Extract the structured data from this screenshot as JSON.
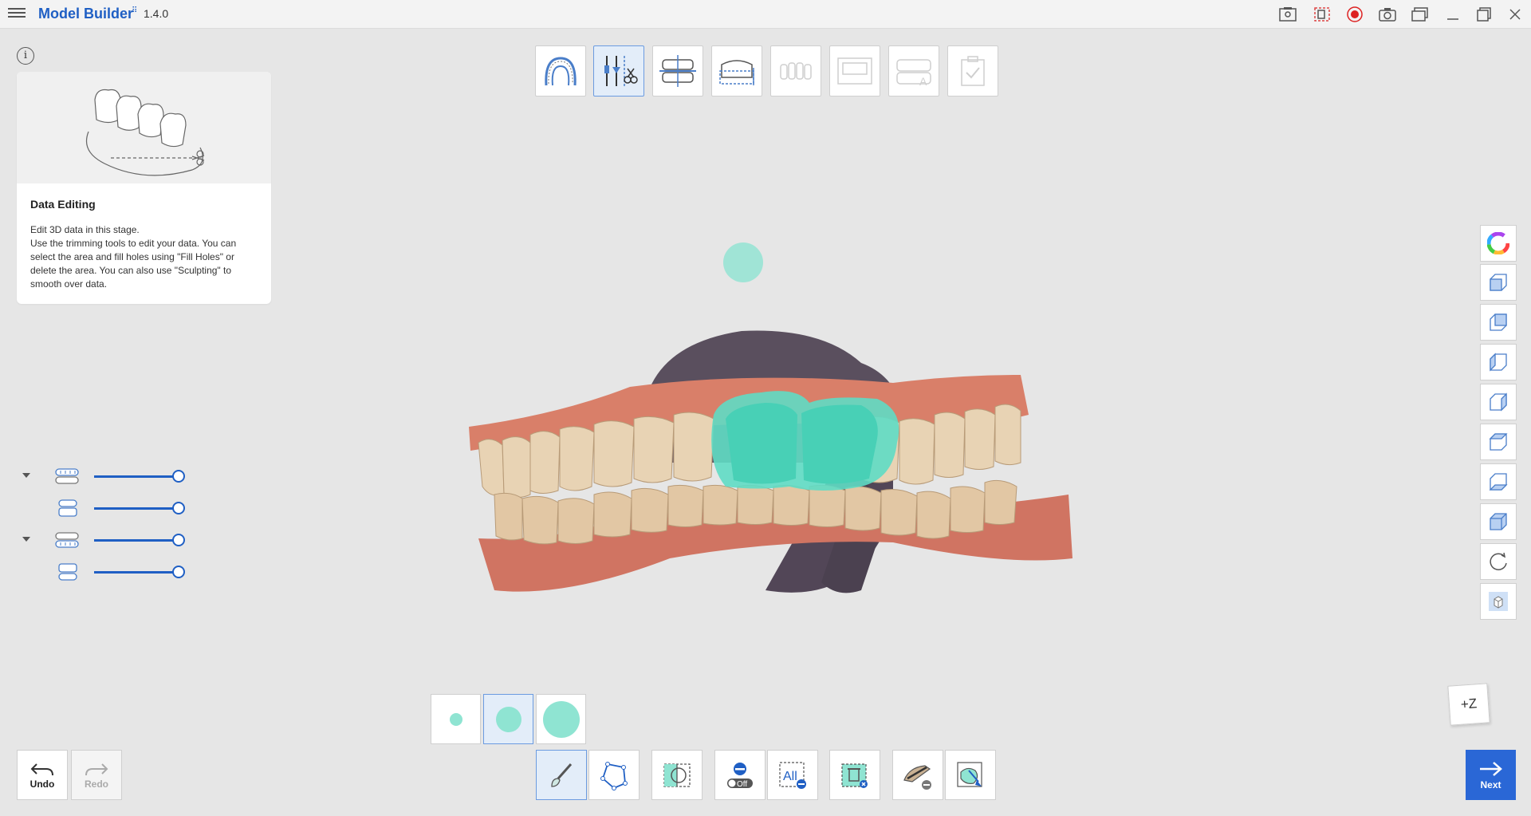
{
  "app": {
    "title": "Model Builder",
    "version": "1.4.0"
  },
  "info": {
    "title": "Data Editing",
    "lines": [
      "Edit 3D data in this stage.",
      "Use the trimming tools to edit your data. You can select the area and fill holes using \"Fill Holes\" or delete the area. You can also use \"Sculpting\" to smooth over data."
    ]
  },
  "stages": [
    {
      "icon": "arch-icon",
      "state": "normal"
    },
    {
      "icon": "edit-tools-icon",
      "state": "active"
    },
    {
      "icon": "occlusion-plane-icon",
      "state": "normal"
    },
    {
      "icon": "base-height-icon",
      "state": "normal"
    },
    {
      "icon": "die-icon",
      "state": "disabled"
    },
    {
      "icon": "model-base-icon",
      "state": "disabled"
    },
    {
      "icon": "label-icon",
      "state": "disabled"
    },
    {
      "icon": "checklist-icon",
      "state": "disabled"
    }
  ],
  "visibility": [
    {
      "name": "upper-jaw",
      "expandable": true,
      "opacity": 1.0
    },
    {
      "name": "upper-sub",
      "expandable": false,
      "opacity": 1.0
    },
    {
      "name": "lower-jaw",
      "expandable": true,
      "opacity": 1.0
    },
    {
      "name": "lower-sub",
      "expandable": false,
      "opacity": 1.0
    }
  ],
  "brush_sizes": [
    {
      "size": "small",
      "active": false
    },
    {
      "size": "medium",
      "active": true
    },
    {
      "size": "large",
      "active": false
    }
  ],
  "tools": {
    "undo_label": "Undo",
    "redo_label": "Redo",
    "next_label": "Next",
    "toggle_label": "Off",
    "all_label": "All",
    "z_label": "+Z"
  },
  "colors": {
    "accent": "#2a67d6",
    "selection": "#5fdcc4",
    "gum": "#d97f69",
    "tooth": "#e8d3b4"
  }
}
